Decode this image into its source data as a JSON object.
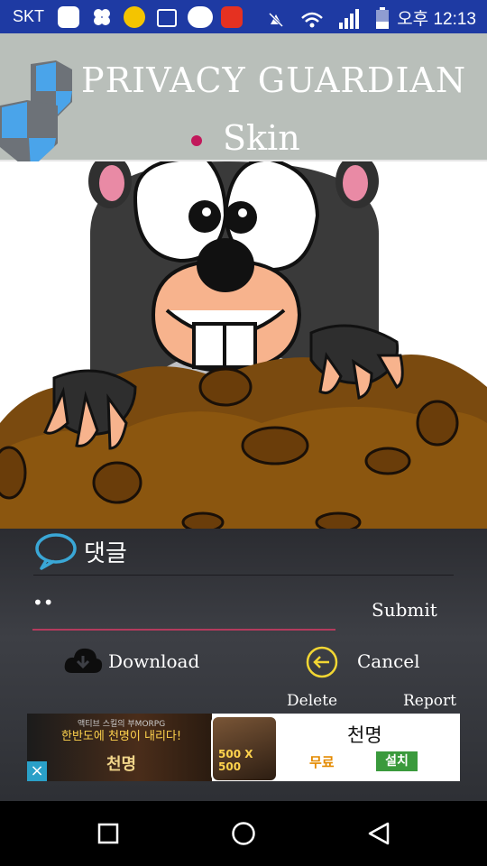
{
  "status_bar": {
    "carrier": "SKT",
    "notification_icons": [
      "emoji-icon",
      "clover-icon",
      "baskin-31-icon",
      "gallery-icon",
      "kakaotalk-icon",
      "pizza-hut-icon"
    ],
    "system_icons": [
      "silent-icon",
      "wifi-icon",
      "signal-icon",
      "battery-icon"
    ],
    "clock": "오후 12:13"
  },
  "header": {
    "title": "PRIVACY GUARDIAN",
    "subtitle": "Skin",
    "accent_color": "#c2185b"
  },
  "comment": {
    "title": "댓글",
    "input_value": "••",
    "submit_label": "Submit",
    "download_label": "Download",
    "cancel_label": "Cancel",
    "delete_label": "Delete",
    "report_label": "Report"
  },
  "ad": {
    "left_small": "액티브 스킬의 부MORPG",
    "left_headline": "한반도에 천명이 내리다!",
    "left_logo": "천명",
    "thumb_badge": "500 X 500",
    "game_title": "천명",
    "free_label": "무료",
    "install_label": "설치",
    "close_label": "×"
  },
  "nav": {
    "buttons": [
      "recent-apps-icon",
      "home-icon",
      "back-icon"
    ]
  },
  "colors": {
    "status_bar": "#1e3aa3",
    "header_bg": "#b9bfba",
    "panel_bg": "#34363b",
    "input_underline": "#b43a5d",
    "icon_cyan": "#3aa7d6",
    "cancel_circle": "#f2d633"
  }
}
